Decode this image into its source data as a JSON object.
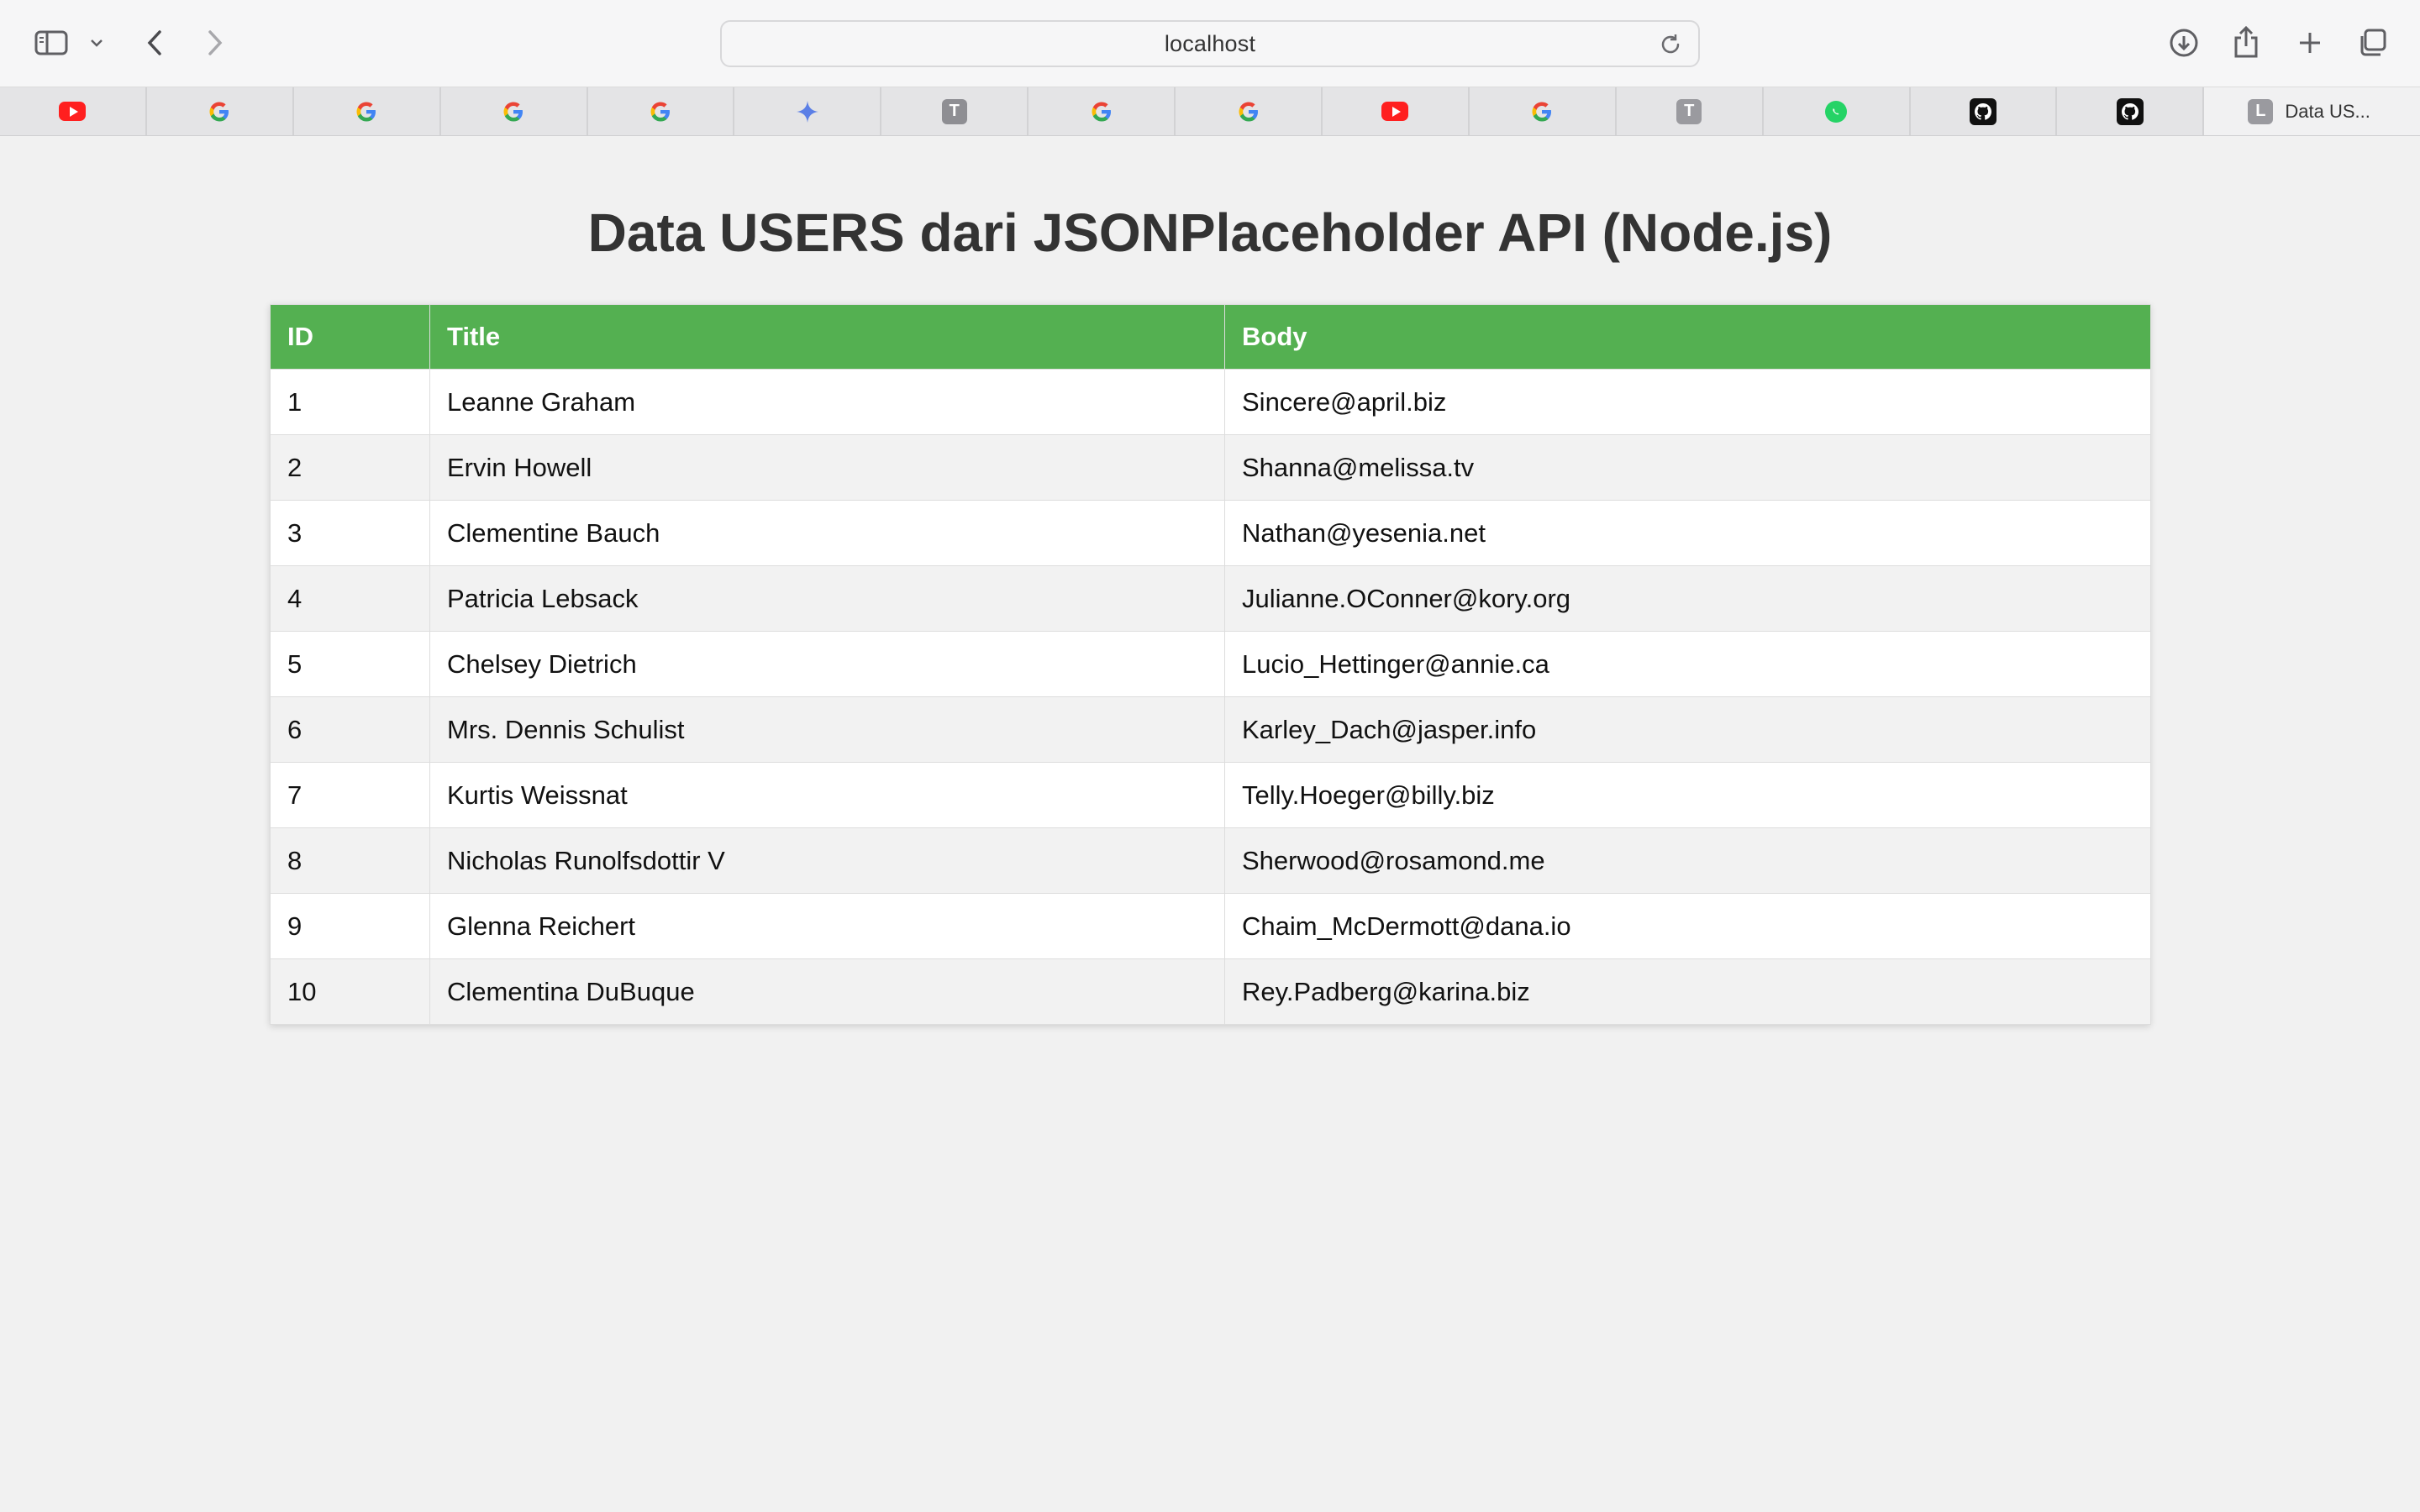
{
  "browser": {
    "url": "localhost",
    "tabs": [
      {
        "icon": "youtube-icon"
      },
      {
        "icon": "google-icon"
      },
      {
        "icon": "google-icon"
      },
      {
        "icon": "google-icon"
      },
      {
        "icon": "google-icon"
      },
      {
        "icon": "gemini-icon"
      },
      {
        "icon": "letter-t-icon",
        "letter": "T"
      },
      {
        "icon": "google-icon"
      },
      {
        "icon": "google-icon"
      },
      {
        "icon": "youtube-icon"
      },
      {
        "icon": "google-icon"
      },
      {
        "icon": "letter-t-icon",
        "letter": "T"
      },
      {
        "icon": "whatsapp-icon"
      },
      {
        "icon": "github-icon"
      },
      {
        "icon": "github-icon"
      }
    ],
    "active_tab": {
      "letter": "L",
      "label": "Data US..."
    }
  },
  "page": {
    "title": "Data USERS dari JSONPlaceholder API (Node.js)"
  },
  "table": {
    "headers": [
      "ID",
      "Title",
      "Body"
    ],
    "rows": [
      {
        "id": "1",
        "title": "Leanne Graham",
        "body": "Sincere@april.biz"
      },
      {
        "id": "2",
        "title": "Ervin Howell",
        "body": "Shanna@melissa.tv"
      },
      {
        "id": "3",
        "title": "Clementine Bauch",
        "body": "Nathan@yesenia.net"
      },
      {
        "id": "4",
        "title": "Patricia Lebsack",
        "body": "Julianne.OConner@kory.org"
      },
      {
        "id": "5",
        "title": "Chelsey Dietrich",
        "body": "Lucio_Hettinger@annie.ca"
      },
      {
        "id": "6",
        "title": "Mrs. Dennis Schulist",
        "body": "Karley_Dach@jasper.info"
      },
      {
        "id": "7",
        "title": "Kurtis Weissnat",
        "body": "Telly.Hoeger@billy.biz"
      },
      {
        "id": "8",
        "title": "Nicholas Runolfsdottir V",
        "body": "Sherwood@rosamond.me"
      },
      {
        "id": "9",
        "title": "Glenna Reichert",
        "body": "Chaim_McDermott@dana.io"
      },
      {
        "id": "10",
        "title": "Clementina DuBuque",
        "body": "Rey.Padberg@karina.biz"
      }
    ]
  },
  "colors": {
    "header_green": "#54b051",
    "page_bg": "#f1f1f1",
    "title_text": "#333333",
    "row_alt": "#f2f2f2"
  }
}
